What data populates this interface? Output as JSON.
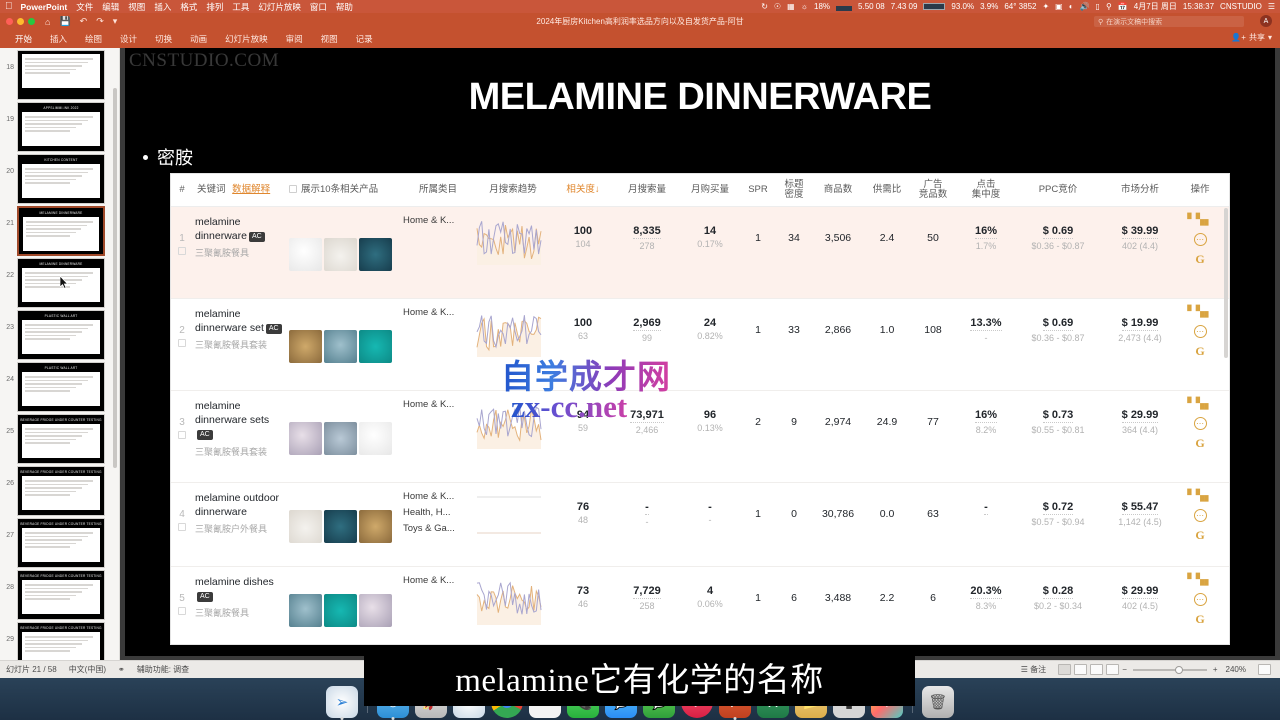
{
  "macbar": {
    "apple": "apple-logo",
    "app": "PowerPoint",
    "menus": [
      "文件",
      "编辑",
      "视图",
      "插入",
      "格式",
      "排列",
      "工具",
      "幻灯片放映",
      "窗口",
      "帮助"
    ],
    "right": {
      "battery": "18%",
      "cpu1": "5.50 08",
      "cpu2": "7.43 09",
      "cpu3": "93.0%",
      "cpu4": "3.9%",
      "weather": "64° 3852",
      "bluetooth": "bluetooth-icon",
      "display": "display-icon",
      "wifi": "wifi-icon",
      "volume": "volume-icon",
      "screen": "screen-icon",
      "search": "search-icon",
      "calendar": "calendar-icon",
      "date": "4月7日 周日",
      "time": "15:38:37",
      "user": "CNSTUDIO",
      "menu": "list-icon"
    }
  },
  "pptbar": {
    "quick": [
      "home-icon",
      "save-icon",
      "undo-icon",
      "redo-icon",
      "more-icon"
    ],
    "doc_title": "2024年厨房Kitchen高利润率选品方向以及自发货产品-阿甘",
    "search_placeholder": "在演示文稿中搜索",
    "avatar": "A",
    "share_label": "共享"
  },
  "ribbon": {
    "tabs": [
      "开始",
      "插入",
      "绘图",
      "设计",
      "切换",
      "动画",
      "幻灯片放映",
      "审阅",
      "视图",
      "记录"
    ],
    "active": "开始"
  },
  "rail": {
    "slides": [
      {
        "num": "18",
        "title": "",
        "kind": "light"
      },
      {
        "num": "19",
        "title": "APPSLIMMI.INK 2022",
        "kind": "dark"
      },
      {
        "num": "20",
        "title": "KITCHEN CONTENT",
        "kind": "dark"
      },
      {
        "num": "21",
        "title": "MELAMINE DINNERWARE",
        "kind": "dark",
        "selected": true
      },
      {
        "num": "22",
        "title": "MELAMINE DINNERWARE",
        "kind": "dark"
      },
      {
        "num": "23",
        "title": "PLASTIC WALL ART",
        "kind": "dark"
      },
      {
        "num": "24",
        "title": "PLASTIC WALL ART",
        "kind": "dark"
      },
      {
        "num": "25",
        "title": "BEVERAGE FRIDGE UNDER COUNTER TESTING",
        "kind": "dark"
      },
      {
        "num": "26",
        "title": "BEVERAGE FRIDGE UNDER COUNTER TESTING",
        "kind": "dark"
      },
      {
        "num": "27",
        "title": "BEVERAGE FRIDGE UNDER COUNTER TESTING",
        "kind": "dark"
      },
      {
        "num": "28",
        "title": "BEVERAGE FRIDGE UNDER COUNTER TESTING",
        "kind": "dark"
      },
      {
        "num": "29",
        "title": "BEVERAGE FRIDGE UNDER COUNTER TESTING",
        "kind": "dark"
      }
    ]
  },
  "slide": {
    "watermark": "CNSTUDIO.COM",
    "title": "MELAMINE DINNERWARE",
    "bullet": "密胺",
    "overlay_watermark_1": "自学成才网",
    "overlay_watermark_2": "zx-cc.net"
  },
  "table": {
    "headers": {
      "num": "#",
      "keyword": "关键词",
      "data_explain": "数据解释",
      "show_related": "展示10条相关产品",
      "category": "所属类目",
      "trend": "月搜索趋势",
      "relevance": "相关度↓",
      "search_volume": "月搜索量",
      "purchase_volume": "月购买量",
      "spr": "SPR",
      "title_density": "标题\n密度",
      "goods_count": "商品数",
      "supply_demand": "供需比",
      "ad_competitors": "广告\n竞品数",
      "click_concentration": "点击\n集中度",
      "ppc_bid": "PPC竞价",
      "market_analysis": "市场分析",
      "actions": "操作"
    },
    "rows": [
      {
        "num": "1",
        "keyword_en": "melamine dinnerware",
        "badge": "AC",
        "keyword_cn": "三聚氰胺餐具",
        "categories": [
          "Home & K..."
        ],
        "relevance": "100",
        "relevance_sub": "104",
        "search_volume": "8,335",
        "search_volume_sub": "278",
        "purchase_volume": "14",
        "purchase_sub": "0.17%",
        "spr": "1",
        "title_density": "34",
        "goods_count": "3,506",
        "supply_demand": "2.4",
        "ad_competitors": "50",
        "click_conc": "16%",
        "click_conc_sub": "1.7%",
        "ppc_bid": "$ 0.69",
        "ppc_range": "$0.36 - $0.87",
        "market_price": "$ 39.99",
        "market_sub": "402 (4.4)",
        "highlight": true
      },
      {
        "num": "2",
        "keyword_en": "melamine dinnerware set",
        "badge": "AC",
        "keyword_cn": "三聚氰胺餐具套装",
        "categories": [
          "Home & K..."
        ],
        "relevance": "100",
        "relevance_sub": "63",
        "search_volume": "2,969",
        "search_volume_sub": "99",
        "purchase_volume": "24",
        "purchase_sub": "0.82%",
        "spr": "1",
        "title_density": "33",
        "goods_count": "2,866",
        "supply_demand": "1.0",
        "ad_competitors": "108",
        "click_conc": "13.3%",
        "click_conc_sub": "-",
        "ppc_bid": "$ 0.69",
        "ppc_range": "$0.36 - $0.87",
        "market_price": "$ 19.99",
        "market_sub": "2,473 (4.4)",
        "highlight": false
      },
      {
        "num": "3",
        "keyword_en": "melamine dinnerware sets",
        "badge": "AC",
        "keyword_cn": "三聚氰胺餐具套装",
        "categories": [
          "Home & K..."
        ],
        "relevance": "94",
        "relevance_sub": "59",
        "search_volume": "73,971",
        "search_volume_sub": "2,466",
        "purchase_volume": "96",
        "purchase_sub": "0.13%",
        "spr": "2",
        "title_density": "9",
        "goods_count": "2,974",
        "supply_demand": "24.9",
        "ad_competitors": "77",
        "click_conc": "16%",
        "click_conc_sub": "8.2%",
        "ppc_bid": "$ 0.73",
        "ppc_range": "$0.55 - $0.81",
        "market_price": "$ 29.99",
        "market_sub": "364 (4.4)",
        "highlight": false
      },
      {
        "num": "4",
        "keyword_en": "melamine outdoor dinnerware",
        "badge": "",
        "keyword_cn": "三聚氰胺户外餐具",
        "categories": [
          "Home & K...",
          "Health, H...",
          "Toys & Ga..."
        ],
        "relevance": "76",
        "relevance_sub": "48",
        "search_volume": "-",
        "search_volume_sub": "-",
        "purchase_volume": "-",
        "purchase_sub": "-",
        "spr": "1",
        "title_density": "0",
        "goods_count": "30,786",
        "supply_demand": "0.0",
        "ad_competitors": "63",
        "click_conc": "-",
        "click_conc_sub": "",
        "ppc_bid": "$ 0.72",
        "ppc_range": "$0.57 - $0.94",
        "market_price": "$ 55.47",
        "market_sub": "1,142 (4.5)",
        "highlight": false
      },
      {
        "num": "5",
        "keyword_en": "melamine dishes",
        "badge": "AC",
        "keyword_cn": "三聚氰胺餐具",
        "categories": [
          "Home & K..."
        ],
        "relevance": "73",
        "relevance_sub": "46",
        "search_volume": "7,729",
        "search_volume_sub": "258",
        "purchase_volume": "4",
        "purchase_sub": "0.06%",
        "spr": "1",
        "title_density": "6",
        "goods_count": "3,488",
        "supply_demand": "2.2",
        "ad_competitors": "6",
        "click_conc": "20.3%",
        "click_conc_sub": "8.3%",
        "ppc_bid": "$ 0.28",
        "ppc_range": "$0.2 - $0.34",
        "market_price": "$ 29.99",
        "market_sub": "402 (4.5)",
        "highlight": false
      }
    ]
  },
  "status": {
    "slide_counter": "幻灯片 21 / 58",
    "language": "中文(中国)",
    "accessibility": "辅助功能: 调查",
    "view_buttons": [
      "normal-view",
      "sorter-view",
      "reading-view",
      "presenter-view"
    ],
    "zoom": "240%",
    "fit_icon": "fit-to-window-icon"
  },
  "caption": {
    "text": "melamine它有化学的名称"
  },
  "dock": {
    "items": [
      "safari-icon",
      "finder-icon",
      "launchpad-icon",
      "safari2-icon",
      "chrome-icon",
      "preview-icon",
      "facetime-icon",
      "messages-icon",
      "music-icon",
      "powerpoint-icon",
      "excel-icon",
      "folder-icon",
      "terminal-icon",
      "photos-icon",
      "trash-icon"
    ]
  },
  "colors": {
    "ribbon": "#c4512f",
    "accent_orange": "#e0872e",
    "action_gold": "#d9a441",
    "highlight_row": "#fdf1ec"
  }
}
